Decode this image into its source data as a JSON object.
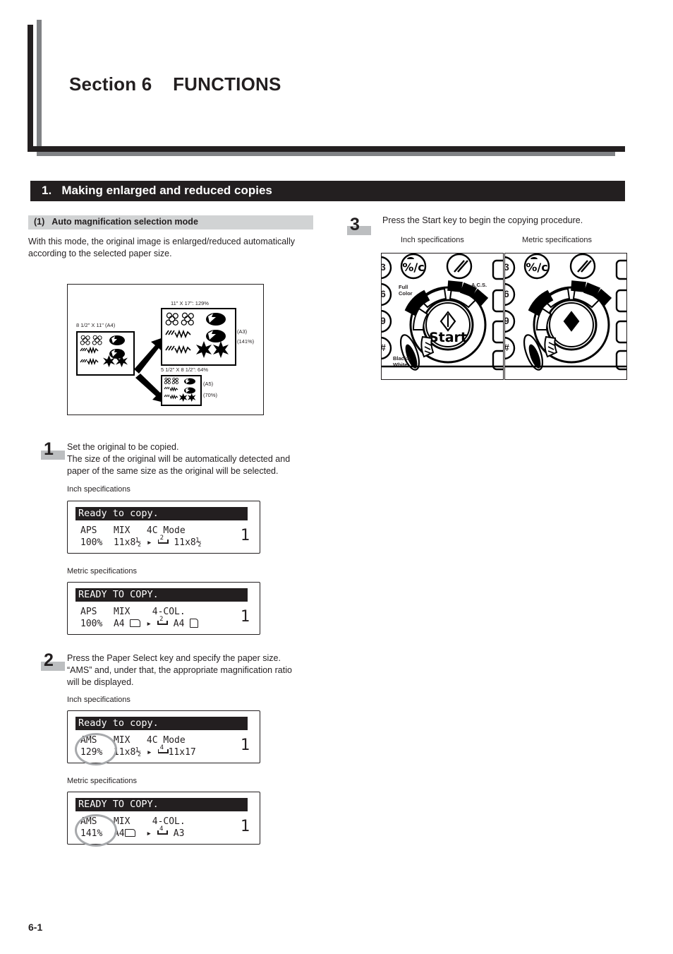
{
  "header": {
    "section_title": "Section 6    FUNCTIONS"
  },
  "section_bar": {
    "label": "1.   Making enlarged and reduced copies"
  },
  "subsection": {
    "label": "(1)   Auto magnification selection mode",
    "intro_line1": "With this mode, the original image is enlarged/reduced automatically",
    "intro_line2": "according to the selected paper size."
  },
  "illustration": {
    "original_label": "8 1/2\" X 11\" (A4)",
    "enlarge_label": "11\" X 17\": 129%",
    "enlarge_size": "(A3)",
    "enlarge_ratio": "(141%)",
    "reduce_label": "5 1/2\" X 8 1/2\": 64%",
    "reduce_size": "(A5)",
    "reduce_ratio": "(70%)"
  },
  "steps": [
    {
      "number": "1",
      "lines": [
        "Set the original to be copied.",
        "The size of the original will be automatically detected and",
        "paper of the same size as the original will be selected."
      ]
    },
    {
      "number": "2",
      "lines": [
        "Press the Paper Select key and specify the paper size.",
        "“AMS” and, under that, the appropriate magnification ratio",
        "will be displayed."
      ]
    },
    {
      "number": "3",
      "lines": [
        "Press the Start key to begin the copying procedure."
      ]
    }
  ],
  "spec_labels": {
    "inch": "Inch specifications",
    "metric": "Metric specifications"
  },
  "lcd_panels": {
    "step1_inch": {
      "title": "Ready to copy.",
      "row1": "APS   MIX   4C Mode",
      "row2_mode": "100%",
      "row2_src": "11x8½",
      "row2_dst": "11x8½",
      "cassette_num": "2",
      "copies": "1",
      "highlight": false
    },
    "step1_metric": {
      "title": "READY TO COPY.",
      "row1": "APS   MIX    4-COL.",
      "row2_mode": "100%",
      "row2_src": "A4",
      "row2_dst": "A4",
      "cassette_num": "2",
      "copies": "1",
      "highlight": false
    },
    "step2_inch": {
      "title": "Ready to copy.",
      "row1": "AMS   MIX   4C Mode",
      "row2_mode": "129%",
      "row2_src": "11x8½",
      "row2_dst": "11x17",
      "cassette_num": "4",
      "copies": "1",
      "highlight": true,
      "hl_top": "AMS",
      "hl_bottom": "129%"
    },
    "step2_metric": {
      "title": "READY TO COPY.",
      "row1": "AMS   MIX    4-COL.",
      "row2_mode": "141%",
      "row2_src": "A4",
      "row2_dst": "A3",
      "cassette_num": "4",
      "copies": "1",
      "highlight": true,
      "hl_top": "AMS",
      "hl_bottom": "141%"
    }
  },
  "control_panel": {
    "inch_caption": "Inch specifications",
    "metric_caption": "Metric specifications",
    "start_label": "Start",
    "full_color_label": "Full\nColor",
    "acs_label": "A.C.S.",
    "black_white_label": "Black&\nWhite",
    "clear_key": "%/c",
    "interrupt_key": "//",
    "keypad_digits": [
      "3",
      "6",
      "9",
      "#"
    ]
  },
  "footer": {
    "page_number": "6-1"
  },
  "colors": {
    "ink": "#231f20",
    "gray_rule": "#808285",
    "gray_bar": "#d1d3d4",
    "step_gray": "#bcbec0",
    "highlight_ring": "#a7a9ac"
  }
}
